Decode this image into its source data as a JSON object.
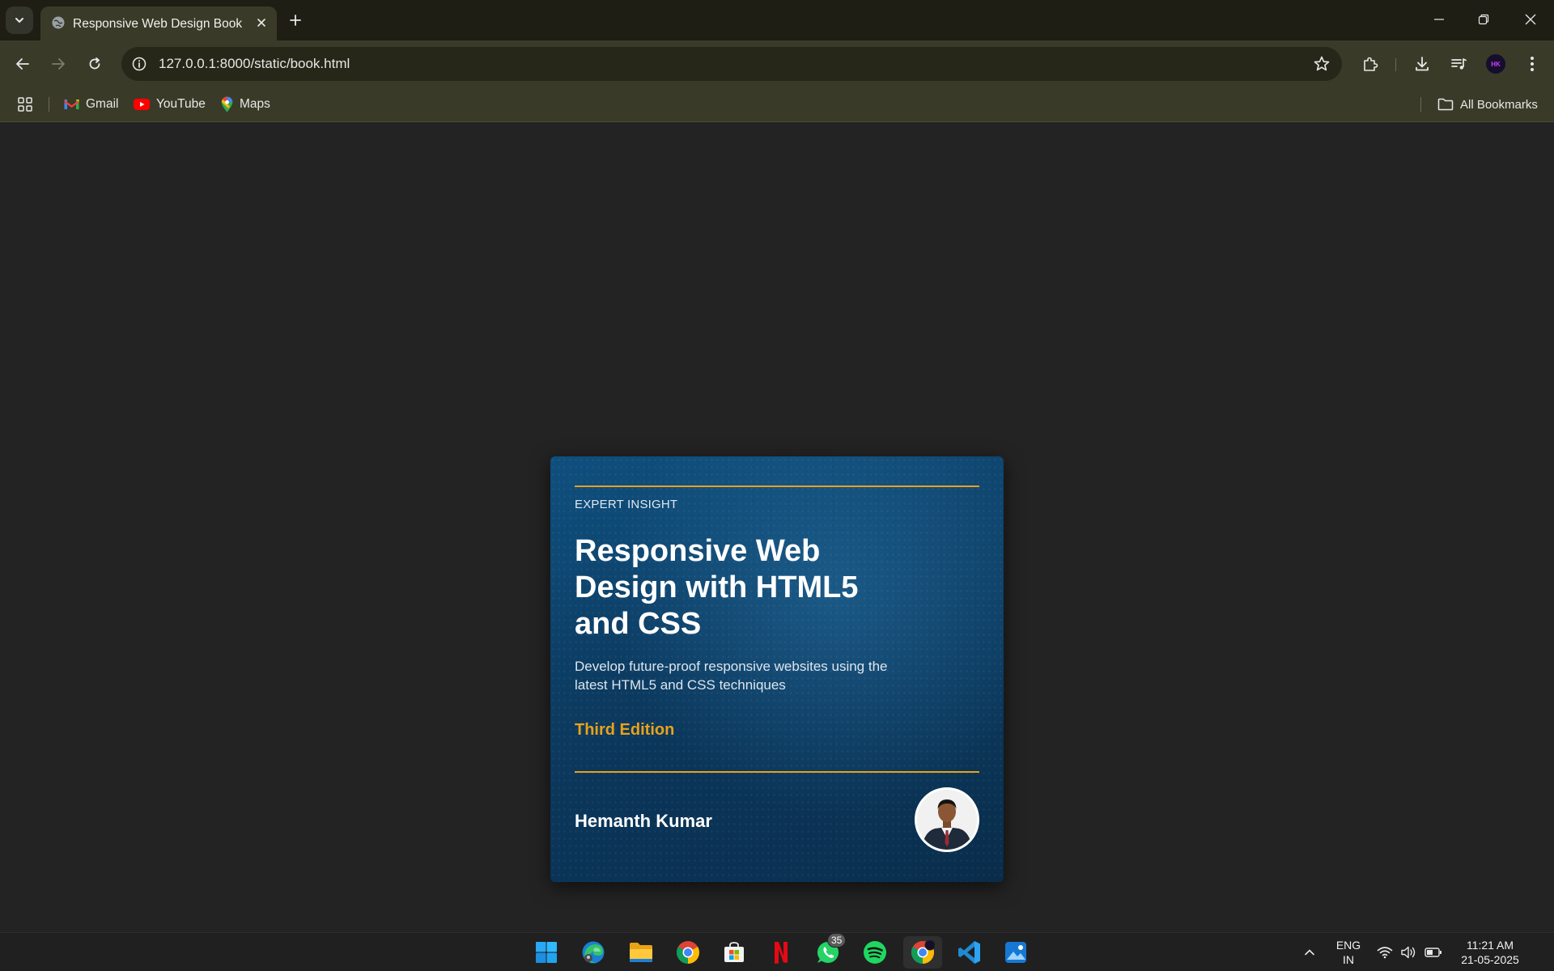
{
  "browser": {
    "tab": {
      "title": "Responsive Web Design Book"
    },
    "address_bar": {
      "url": "127.0.0.1:8000/static/book.html"
    },
    "bookmarks": [
      {
        "label": "Gmail",
        "icon": "gmail-icon"
      },
      {
        "label": "YouTube",
        "icon": "youtube-icon"
      },
      {
        "label": "Maps",
        "icon": "maps-icon"
      }
    ],
    "all_bookmarks_label": "All Bookmarks",
    "profile_initials": "HK"
  },
  "book": {
    "eyebrow": "EXPERT INSIGHT",
    "title": "Responsive Web Design with HTML5 and CSS",
    "subtitle": "Develop future-proof responsive websites using the latest HTML5 and CSS techniques",
    "edition": "Third Edition",
    "author": "Hemanth Kumar",
    "accent_color": "#e8a21a",
    "background_color": "#0d3f66"
  },
  "taskbar": {
    "apps": [
      "start",
      "edge",
      "file-explorer",
      "chrome",
      "microsoft-store",
      "netflix",
      "whatsapp",
      "spotify",
      "chrome-profile",
      "vscode",
      "photos"
    ],
    "whatsapp_badge": "35",
    "language": {
      "line1": "ENG",
      "line2": "IN"
    },
    "clock": {
      "time": "11:21 AM",
      "date": "21-05-2025"
    }
  }
}
